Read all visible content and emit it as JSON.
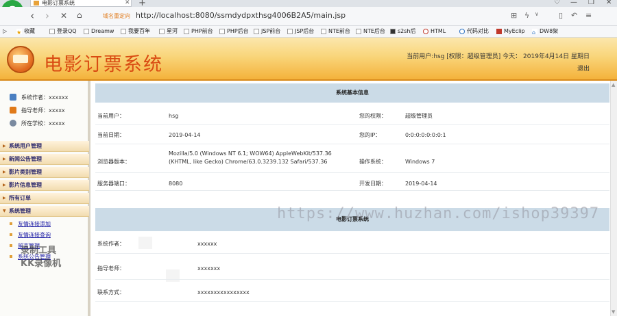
{
  "browser": {
    "tab_title": "电影订票系统",
    "url_hint": "域名重定向",
    "url": "http://localhost:8080/ssmdydpxthsg4006B2A5/main.jsp",
    "bookmarks": [
      "收藏",
      "登录QQ",
      "Dreamw",
      "我要百年",
      "星河",
      "PHP前台",
      "PHP后台",
      "JSP前台",
      "JSP后台",
      "NTE前台",
      "NTE后台",
      "s2sh后",
      "HTML",
      "代码对比",
      "MyEclip",
      "DW8架"
    ]
  },
  "header": {
    "title": "电影订票系统",
    "user_info": "当前用户:hsg [权限：超级管理员] 今天： 2019年4月14日 星期日",
    "logout": "退出"
  },
  "sidebar": {
    "info": [
      {
        "text": "系统作者：xxxxxx",
        "icon": "user-icon",
        "color": "#4a7fc1"
      },
      {
        "text": "指导老师：xxxxx",
        "icon": "teacher-icon",
        "color": "#e07a1a"
      },
      {
        "text": "所在学校：xxxxx",
        "icon": "school-icon",
        "color": "#7a8aa0"
      }
    ],
    "menus": [
      "系统用户管理",
      "新闻公告管理",
      "影片类别管理",
      "影片信息管理",
      "所有订单",
      "系统管理"
    ],
    "submenus": [
      "友情连接添加",
      "友情连接查询",
      "留言管理",
      "系统公告管理"
    ]
  },
  "system_info": {
    "heading": "系统基本信息",
    "rows": [
      {
        "label1": "当前用户：",
        "value1": "hsg",
        "label2": "您的权限：",
        "value2": "超级管理员"
      },
      {
        "label1": "当前日期：",
        "value1": "2019-04-14",
        "label2": "您的IP：",
        "value2": "0:0:0:0:0:0:0:1"
      },
      {
        "label1": "浏览器版本：",
        "value1_line1": "Mozilla/5.0 (Windows NT 6.1; WOW64) AppleWebKit/537.36",
        "value1_line2": "(KHTML, like Gecko) Chrome/63.0.3239.132 Safari/537.36",
        "label2": "操作系统：",
        "value2": "Windows 7"
      },
      {
        "label1": "服务器端口：",
        "value1": "8080",
        "label2": "开发日期：",
        "value2": "2019-04-14"
      }
    ]
  },
  "developer_info": {
    "heading": "电影订票系统",
    "rows": [
      {
        "label": "系统作者：",
        "value": "xxxxxx"
      },
      {
        "label": "指导老师：",
        "value": "xxxxxxx"
      },
      {
        "label": "联系方式：",
        "value": "xxxxxxxxxxxxxxxx"
      }
    ]
  },
  "overlay": {
    "watermark": "https://www.huzhan.com/ishop39397",
    "kk_line1": "录制工具",
    "kk_line2": "KK录像机"
  }
}
